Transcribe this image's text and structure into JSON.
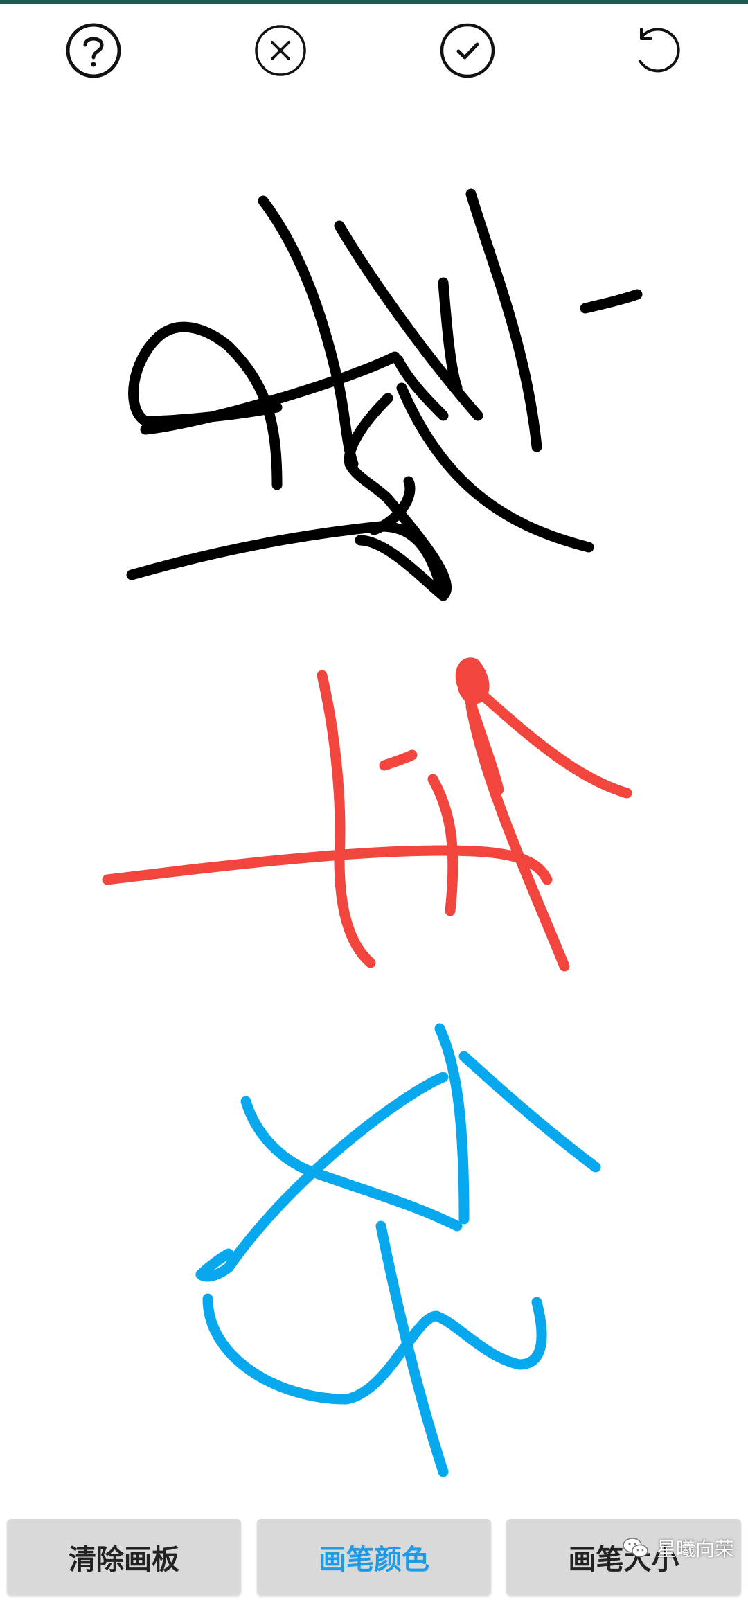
{
  "toolbar": {
    "help_icon": "help-circle-icon",
    "cancel_icon": "close-circle-icon",
    "confirm_icon": "check-circle-icon",
    "undo_icon": "undo-icon"
  },
  "buttons": {
    "clear": "清除画板",
    "pen_color": "画笔颜色",
    "pen_size": "画笔大小"
  },
  "colors": {
    "accent": "#1e9be6",
    "stroke_black": "#000000",
    "stroke_red": "#f2453d",
    "stroke_blue": "#08a8ee",
    "status": "#1f5b53"
  },
  "watermark": "星曦向荣"
}
